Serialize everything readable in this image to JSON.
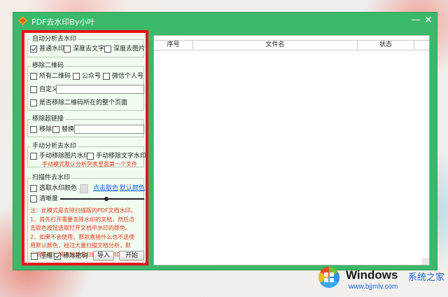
{
  "window": {
    "title": "PDF去水印By小叶",
    "min_symbol": "—",
    "close_symbol": "✕"
  },
  "auto": {
    "legend": "自动分析去水印",
    "normal": {
      "label": "普通水印",
      "checked": true
    },
    "deep_text": {
      "label": "深度去文字",
      "checked": false
    },
    "deep_image": {
      "label": "深度去图片",
      "checked": false
    }
  },
  "qrcode": {
    "legend": "移除二维码",
    "all": "所有二维码",
    "official": "公众号",
    "wechat": "微信个人号",
    "custom": "自定义",
    "custom_value": "",
    "whole_page": "是否移除二维码所在的整个页面"
  },
  "hyperlink": {
    "legend": "移除超链接",
    "remove": "移除",
    "replace": "替换",
    "replace_value": ""
  },
  "manual": {
    "legend": "手动分析去水印",
    "image": "手动移除图片水印",
    "text": "手动移除文字水印",
    "note": "手动模式默认分析列表里面第一个文件"
  },
  "scan": {
    "legend": "扫描件去水印",
    "pick_color": "选取水印颜色",
    "click_pick": "点击取色",
    "default_color": "默认颜色",
    "clarity": "清晰度",
    "clarity_level": 0.55,
    "note": [
      "注：此模式是去除扫描版的PDF文档水印。",
      "1、首先打开需要去除水印的文档，然后点",
      "击取色按钮选取打开文档中水印的颜色。",
      "2、如果不会使用，那就直接什么也不选使",
      "用默认颜色，经过大量扫描文档分析，默",
      "认颜色可以解决大部分扫描文档水印。"
    ]
  },
  "bottom": {
    "compress": "压缩",
    "remove_password": "移除密码",
    "remove_password_checked": true,
    "import": "导入",
    "start": "开始"
  },
  "table": {
    "columns": [
      "序号",
      "文件名",
      "状态"
    ],
    "rows": []
  },
  "watermark": {
    "brand": "Windows",
    "cn": "系统之家",
    "url": "www.bjjmlv.com"
  },
  "colors": {
    "window_green": "#3bb86a",
    "panel_bg": "#f1fdf1",
    "highlight_red": "#e8141b",
    "note_red": "#e0381c",
    "link_blue": "#1f5fd6"
  }
}
